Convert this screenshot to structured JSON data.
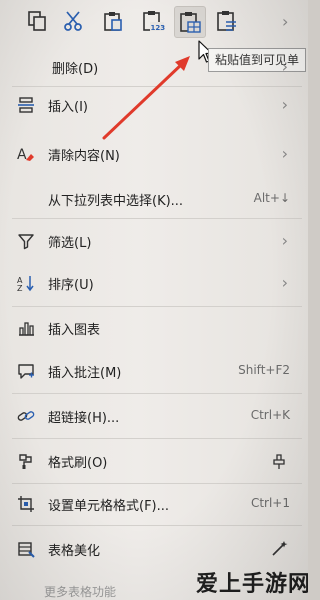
{
  "toolbar": {
    "buttons": [
      {
        "name": "copy-icon"
      },
      {
        "name": "scissors-icon"
      },
      {
        "name": "paste-icon"
      },
      {
        "name": "paste-values-icon"
      },
      {
        "name": "paste-visible-icon"
      },
      {
        "name": "paste-format-icon"
      }
    ],
    "more": "›"
  },
  "tooltip": "粘贴值到可见单",
  "items": {
    "delete": {
      "label": "删除(D)",
      "arrow": "›"
    },
    "insert": {
      "label": "插入(I)",
      "arrow": "›"
    },
    "clear": {
      "label": "清除内容(N)",
      "arrow": "›"
    },
    "pick_from_list": {
      "label": "从下拉列表中选择(K)...",
      "shortcut": "Alt+↓"
    },
    "filter": {
      "label": "筛选(L)",
      "arrow": "›"
    },
    "sort": {
      "label": "排序(U)",
      "arrow": "›"
    },
    "insert_chart": {
      "label": "插入图表"
    },
    "insert_comment": {
      "label": "插入批注(M)",
      "shortcut": "Shift+F2"
    },
    "hyperlink": {
      "label": "超链接(H)...",
      "shortcut": "Ctrl+K"
    },
    "format_painter": {
      "label": "格式刷(O)"
    },
    "format_cells": {
      "label": "设置单元格格式(F)...",
      "shortcut": "Ctrl+1"
    },
    "table_beautify": {
      "label": "表格美化"
    },
    "more_table_functions": {
      "label": "更多表格功能"
    }
  },
  "watermark": "爱上手游网",
  "colors": {
    "arrow": "#e03a2b",
    "accent": "#1f6fd1",
    "menu_bg": "#ebe8e4"
  }
}
